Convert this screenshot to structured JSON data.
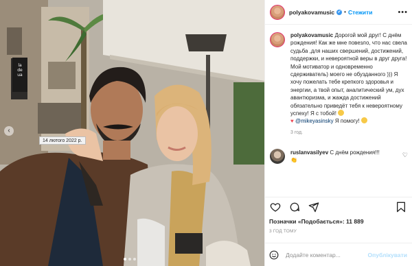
{
  "post": {
    "username": "polyakovamusic",
    "verified_mark": "✔",
    "separator": "•",
    "follow_label": "Стежити",
    "more_label": "•••"
  },
  "caption": {
    "username": "polyakovamusic",
    "text_1": "Дорогой мой друг! С днём рождения! Как же мне повезло, что нас свела судьба ,для наших свершений, достижений, поддержки, и невероятной веры в друг друга! Мой мотиватор и одновременно сдерживатель) моего не обузданного ))) Я хочу пожелать тебе крепкого здоровья и энергии, а твой опыт, аналитический ум, дух авантюризма, и жажда достижений обязательно приведёт тебя к невероятному успеху! Я с тобой!",
    "heart": "♥",
    "mention": "@mikeyasinsky",
    "text_2": "Я помогу!",
    "time_ago": "3 год."
  },
  "tooltip": {
    "date": "14 лютого 2022 р."
  },
  "comment": {
    "username": "ruslanvasilyev",
    "text": "С днём рождения!!!",
    "emoji": "👏",
    "like_icon": "♡"
  },
  "engagement": {
    "likes_text": "Позначки «Подобається»: 11 889",
    "posted_ago": "3 ГОД ТОМУ"
  },
  "composer": {
    "placeholder": "Додайте коментар...",
    "publish_label": "Опублікувати"
  },
  "photo": {
    "nav_prev": "‹",
    "sign_text": "la\nde\nua",
    "slide_count": 3,
    "active_slide": 1
  },
  "colors": {
    "accent": "#0095f6",
    "like": "#ed4956",
    "verified": "#3897f0",
    "muted": "#8e8e8e"
  },
  "icons": [
    "heart-icon",
    "comment-icon",
    "share-icon",
    "bookmark-icon",
    "emoji-icon",
    "more-icon"
  ]
}
